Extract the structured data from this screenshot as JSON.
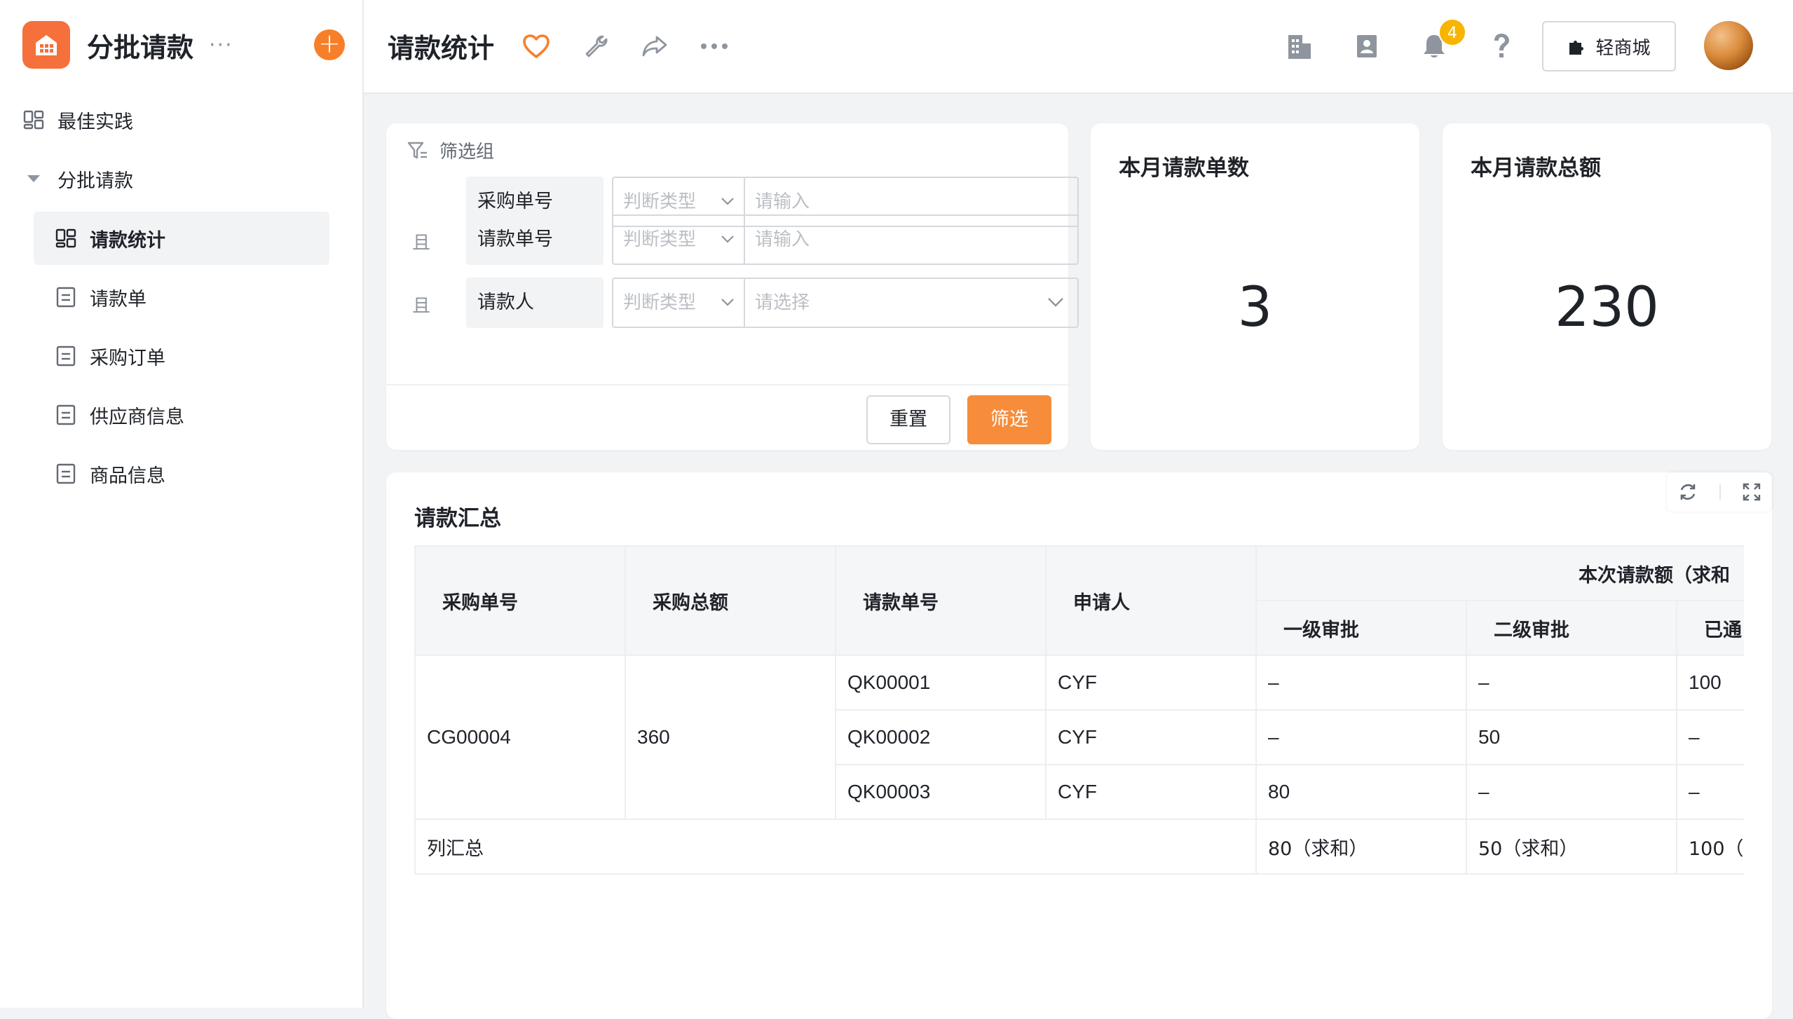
{
  "app": {
    "name": "分批请款",
    "more": "···",
    "add": "+"
  },
  "sidebar": {
    "items": [
      {
        "label": "最佳实践",
        "icon": "dashboard-icon"
      },
      {
        "label": "分批请款",
        "icon": "caret-down-icon"
      },
      {
        "label": "请款统计",
        "icon": "dashboard-icon"
      },
      {
        "label": "请款单",
        "icon": "form-icon"
      },
      {
        "label": "采购订单",
        "icon": "form-icon"
      },
      {
        "label": "供应商信息",
        "icon": "form-icon"
      },
      {
        "label": "商品信息",
        "icon": "form-icon"
      }
    ]
  },
  "header": {
    "title": "请款统计",
    "notification_count": "4",
    "mall_label": "轻商城"
  },
  "filter": {
    "group_label": "筛选组",
    "rows": [
      {
        "conj": "",
        "field": "采购单号",
        "judge": "判断类型",
        "value": "请输入"
      },
      {
        "conj": "且",
        "field": "请款单号",
        "judge": "判断类型",
        "value": "请输入"
      },
      {
        "conj": "且",
        "field": "请款人",
        "judge": "判断类型",
        "value": "请选择"
      }
    ],
    "reset_label": "重置",
    "submit_label": "筛选"
  },
  "stats": {
    "count_title": "本月请款单数",
    "count_value": "3",
    "total_title": "本月请款总额",
    "total_value": "230"
  },
  "summary": {
    "title": "请款汇总",
    "headers": {
      "po_no": "采购单号",
      "po_total": "采购总额",
      "req_no": "请款单号",
      "applicant": "申请人",
      "group": "本次请款额（求和",
      "level1": "一级审批",
      "level2": "二级审批",
      "passed": "已通"
    },
    "group_row": {
      "po_no": "CG00004",
      "po_total": "360"
    },
    "rows": [
      {
        "req_no": "QK00001",
        "applicant": "CYF",
        "level1": "–",
        "level2": "–",
        "passed": "100"
      },
      {
        "req_no": "QK00002",
        "applicant": "CYF",
        "level1": "–",
        "level2": "50",
        "passed": "–"
      },
      {
        "req_no": "QK00003",
        "applicant": "CYF",
        "level1": "80",
        "level2": "–",
        "passed": "–"
      }
    ],
    "total": {
      "label": "列汇总",
      "level1": "80（求和）",
      "level2": "50（求和）",
      "passed": "100（"
    }
  },
  "colors": {
    "accent": "#f78c3a",
    "logo": "#f5703b",
    "badge": "#f7b500"
  }
}
